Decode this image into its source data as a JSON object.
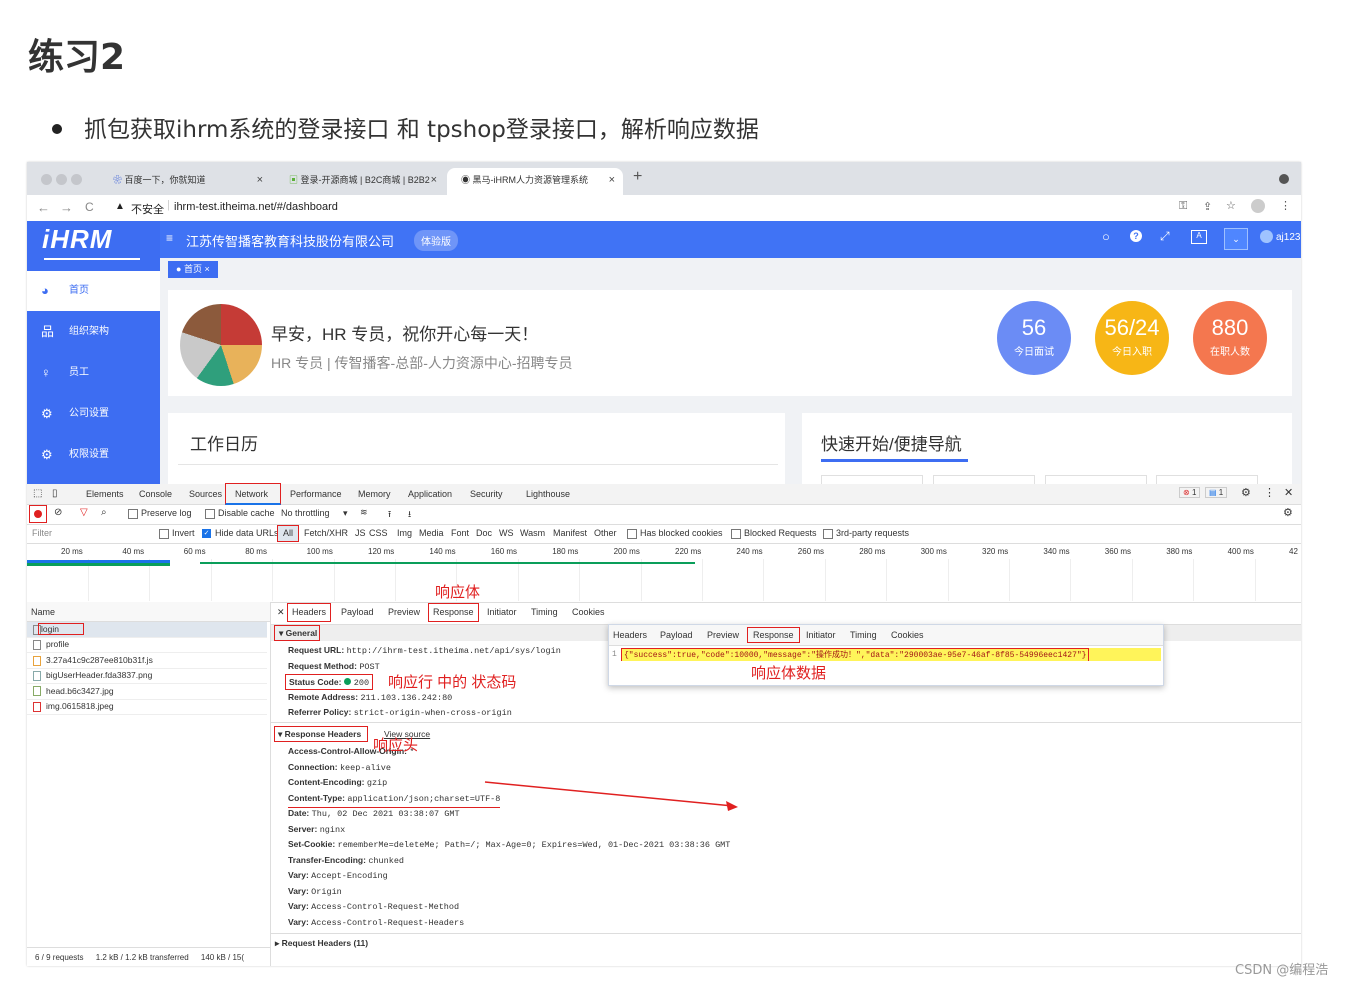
{
  "doc": {
    "title": "练习2",
    "bullet": "抓包获取ihrm系统的登录接口 和 tpshop登录接口，解析响应数据",
    "watermark": "CSDN @编程浩"
  },
  "browser": {
    "tabs": [
      {
        "title": "百度一下，你就知道",
        "close": "×"
      },
      {
        "title": "登录-开源商城 | B2C商城 | B2B2",
        "close": "×"
      },
      {
        "title": "黑马-iHRM人力资源管理系统",
        "close": "×"
      }
    ],
    "new_tab": "+",
    "nav": {
      "back": "←",
      "forward": "→",
      "reload": "C"
    },
    "insecure_label": "不安全",
    "url": "ihrm-test.itheima.net/#/dashboard"
  },
  "app": {
    "logo": "iHRM",
    "company": "江苏传智播客教育科技股份有限公司",
    "badge": "体验版",
    "user": "aj123",
    "tag": "首页",
    "menu": [
      {
        "label": "首页",
        "icon": "dashboard-icon",
        "glyph": "◕"
      },
      {
        "label": "组织架构",
        "icon": "org-tree-icon",
        "glyph": "品"
      },
      {
        "label": "员工",
        "icon": "employee-icon",
        "glyph": "♀"
      },
      {
        "label": "公司设置",
        "icon": "gear-icon",
        "glyph": "⚙"
      },
      {
        "label": "权限设置",
        "icon": "permission-icon",
        "glyph": "⚙"
      }
    ],
    "greeting": "早安，HR 专员，祝你开心每一天！",
    "subtitle": "HR 专员 | 传智播客-总部-人力资源中心-招聘专员",
    "stats": [
      {
        "num": "56",
        "label": "今日面试",
        "color": "#6b8cf5"
      },
      {
        "num": "56/24",
        "label": "今日入职",
        "color": "#f7b616"
      },
      {
        "num": "880",
        "label": "在职人数",
        "color": "#f4774f"
      }
    ],
    "calendar_title": "工作日历",
    "quick_title": "快速开始/便捷导航"
  },
  "devtools": {
    "tabs": [
      "Elements",
      "Console",
      "Sources",
      "Network",
      "Performance",
      "Memory",
      "Application",
      "Security",
      "Lighthouse"
    ],
    "error_count": "1",
    "msg_count": "1",
    "toolbar": {
      "preserve_log": "Preserve log",
      "disable_cache": "Disable cache",
      "throttling": "No throttling"
    },
    "filter": {
      "placeholder": "Filter",
      "invert": "Invert",
      "hide_data": "Hide data URLs",
      "types": [
        "All",
        "Fetch/XHR",
        "JS",
        "CSS",
        "Img",
        "Media",
        "Font",
        "Doc",
        "WS",
        "Wasm",
        "Manifest",
        "Other"
      ],
      "blocked_cookies": "Has blocked cookies",
      "blocked_requests": "Blocked Requests",
      "third_party": "3rd-party requests"
    },
    "timeline_ticks": [
      "20 ms",
      "40 ms",
      "60 ms",
      "80 ms",
      "100 ms",
      "120 ms",
      "140 ms",
      "160 ms",
      "180 ms",
      "200 ms",
      "220 ms",
      "240 ms",
      "260 ms",
      "280 ms",
      "300 ms",
      "320 ms",
      "340 ms",
      "360 ms",
      "380 ms",
      "400 ms",
      "42"
    ],
    "name_header": "Name",
    "requests": [
      "login",
      "profile",
      "3.27a41c9c287ee810b31f.js",
      "bigUserHeader.fda3837.png",
      "head.b6c3427.jpg",
      "img.0615818.jpeg"
    ],
    "status_bar": [
      "6 / 9 requests",
      "1.2 kB / 1.2 kB transferred",
      "140 kB / 15("
    ],
    "detail_tabs": [
      "Headers",
      "Payload",
      "Preview",
      "Response",
      "Initiator",
      "Timing",
      "Cookies"
    ],
    "general_title": "General",
    "general": [
      {
        "k": "Request URL:",
        "v": "http://ihrm-test.itheima.net/api/sys/login"
      },
      {
        "k": "Request Method:",
        "v": "POST"
      },
      {
        "k": "Status Code:",
        "v": "200"
      },
      {
        "k": "Remote Address:",
        "v": "211.103.136.242:80"
      },
      {
        "k": "Referrer Policy:",
        "v": "strict-origin-when-cross-origin"
      }
    ],
    "response_headers_title": "Response Headers",
    "view_source": "View source",
    "response_headers": [
      {
        "k": "Access-Control-Allow-Origin:",
        "v": "*"
      },
      {
        "k": "Connection:",
        "v": "keep-alive"
      },
      {
        "k": "Content-Encoding:",
        "v": "gzip"
      },
      {
        "k": "Content-Type:",
        "v": "application/json;charset=UTF-8"
      },
      {
        "k": "Date:",
        "v": "Thu, 02 Dec 2021 03:38:07 GMT"
      },
      {
        "k": "Server:",
        "v": "nginx"
      },
      {
        "k": "Set-Cookie:",
        "v": "rememberMe=deleteMe; Path=/; Max-Age=0; Expires=Wed, 01-Dec-2021 03:38:36 GMT"
      },
      {
        "k": "Transfer-Encoding:",
        "v": "chunked"
      },
      {
        "k": "Vary:",
        "v": "Accept-Encoding"
      },
      {
        "k": "Vary:",
        "v": "Origin"
      },
      {
        "k": "Vary:",
        "v": "Access-Control-Request-Method"
      },
      {
        "k": "Vary:",
        "v": "Access-Control-Request-Headers"
      }
    ],
    "request_headers_title": "Request Headers (11)",
    "popup": {
      "tabs": [
        "Headers",
        "Payload",
        "Preview",
        "Response",
        "Initiator",
        "Timing",
        "Cookies"
      ],
      "line_no": "1",
      "json": "{\"success\":true,\"code\":10000,\"message\":\"操作成功！\",\"data\":\"290003ae-95e7-46af-8f85-54996eec1427\"}"
    }
  },
  "annotations": {
    "response_body": "响应体",
    "status_code": "响应行 中的 状态码",
    "response_data": "响应体数据",
    "response_header": "响应头"
  }
}
